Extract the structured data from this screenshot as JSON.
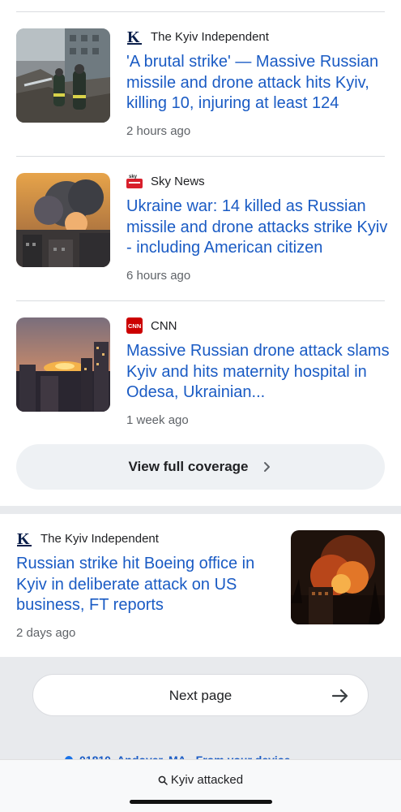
{
  "articles": [
    {
      "source": "The Kyiv Independent",
      "logo_icon": "kyiv-independent-logo",
      "headline": "'A brutal strike' — Massive Russian missile and drone attack hits Kyiv, killing 10, injuring at least 124",
      "age": "2 hours ago"
    },
    {
      "source": "Sky News",
      "logo_icon": "sky-news-logo",
      "headline": "Ukraine war: 14 killed as Russian missile and drone attacks strike Kyiv - including American citizen",
      "age": "6 hours ago"
    },
    {
      "source": "CNN",
      "logo_icon": "cnn-logo",
      "headline": "Massive Russian drone attack slams Kyiv and hits maternity hospital in Odesa, Ukrainian...",
      "age": "1 week ago"
    }
  ],
  "coverage": {
    "label": "View full coverage"
  },
  "standalone": {
    "source": "The Kyiv Independent",
    "logo_icon": "kyiv-independent-logo",
    "headline": "Russian strike hit Boeing office in Kyiv in deliberate attack on US business, FT reports",
    "age": "2 days ago"
  },
  "pagination": {
    "next_label": "Next page"
  },
  "footer": {
    "location": "01810, Andover, MA - From your device"
  },
  "search": {
    "query": "Kyiv attacked"
  },
  "colors": {
    "link": "#1a5bc4",
    "muted": "#5f6368",
    "accent": "#1a73e8"
  }
}
